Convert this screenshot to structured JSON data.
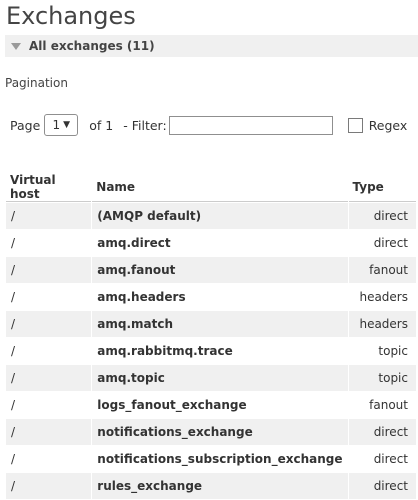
{
  "title": "Exchanges",
  "section": {
    "label": "All exchanges (11)"
  },
  "pagination": {
    "heading": "Pagination",
    "page_label": "Page",
    "page_value": "1",
    "of_label": "of 1",
    "filter_label": "- Filter:",
    "filter_value": "",
    "regex_label": "Regex"
  },
  "table": {
    "headers": [
      "Virtual host",
      "Name",
      "Type"
    ],
    "rows": [
      {
        "vhost": "/",
        "name": "(AMQP default)",
        "type": "direct"
      },
      {
        "vhost": "/",
        "name": "amq.direct",
        "type": "direct"
      },
      {
        "vhost": "/",
        "name": "amq.fanout",
        "type": "fanout"
      },
      {
        "vhost": "/",
        "name": "amq.headers",
        "type": "headers"
      },
      {
        "vhost": "/",
        "name": "amq.match",
        "type": "headers"
      },
      {
        "vhost": "/",
        "name": "amq.rabbitmq.trace",
        "type": "topic"
      },
      {
        "vhost": "/",
        "name": "amq.topic",
        "type": "topic"
      },
      {
        "vhost": "/",
        "name": "logs_fanout_exchange",
        "type": "fanout"
      },
      {
        "vhost": "/",
        "name": "notifications_exchange",
        "type": "direct"
      },
      {
        "vhost": "/",
        "name": "notifications_subscription_exchange",
        "type": "direct"
      },
      {
        "vhost": "/",
        "name": "rules_exchange",
        "type": "direct"
      }
    ]
  }
}
